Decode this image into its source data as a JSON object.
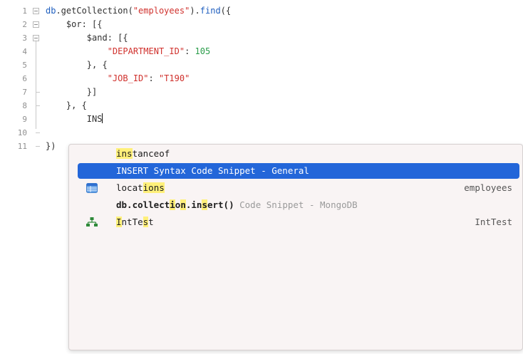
{
  "editor": {
    "line_numbers": [
      "1",
      "2",
      "3",
      "4",
      "5",
      "6",
      "7",
      "8",
      "9",
      "10",
      "11"
    ],
    "lines": [
      {
        "parts": [
          {
            "t": "db",
            "c": "kw"
          },
          {
            "t": ".getCollection(",
            "c": "plain"
          },
          {
            "t": "\"employees\"",
            "c": "str"
          },
          {
            "t": ").",
            "c": "plain"
          },
          {
            "t": "find",
            "c": "fn"
          },
          {
            "t": "({",
            "c": "plain"
          }
        ]
      },
      {
        "parts": [
          {
            "t": "    $or: [{",
            "c": "plain"
          }
        ]
      },
      {
        "parts": [
          {
            "t": "        $and: [{",
            "c": "plain"
          }
        ]
      },
      {
        "parts": [
          {
            "t": "            ",
            "c": "plain"
          },
          {
            "t": "\"DEPARTMENT_ID\"",
            "c": "str"
          },
          {
            "t": ": ",
            "c": "plain"
          },
          {
            "t": "105",
            "c": "num"
          }
        ]
      },
      {
        "parts": [
          {
            "t": "        }, {",
            "c": "plain"
          }
        ]
      },
      {
        "parts": [
          {
            "t": "            ",
            "c": "plain"
          },
          {
            "t": "\"JOB_ID\"",
            "c": "str"
          },
          {
            "t": ": ",
            "c": "plain"
          },
          {
            "t": "\"T190\"",
            "c": "str"
          }
        ]
      },
      {
        "parts": [
          {
            "t": "        }]",
            "c": "plain"
          }
        ]
      },
      {
        "parts": [
          {
            "t": "    }, {",
            "c": "plain"
          }
        ]
      },
      {
        "parts": [
          {
            "t": "        INS",
            "c": "plain"
          }
        ]
      },
      {
        "parts": []
      },
      {
        "parts": [
          {
            "t": "})",
            "c": "plain"
          }
        ]
      }
    ]
  },
  "autocomplete": {
    "items": [
      {
        "icon": "none",
        "segments": [
          {
            "t": "ins",
            "hl": true
          },
          {
            "t": "tanceof"
          }
        ],
        "right": "",
        "selected": false
      },
      {
        "icon": "none",
        "segments": [
          {
            "t": "INSERT Syntax Code Snippet - General"
          }
        ],
        "right": "",
        "selected": true
      },
      {
        "icon": "table-icon",
        "segments": [
          {
            "t": "locat"
          },
          {
            "t": "ions",
            "hl": true
          }
        ],
        "right": "employees",
        "selected": false
      },
      {
        "icon": "none",
        "segments": [
          {
            "t": "db.collect",
            "b": true
          },
          {
            "t": "i",
            "hl": true,
            "b": true
          },
          {
            "t": "o",
            "b": true
          },
          {
            "t": "n",
            "hl": true,
            "b": true
          },
          {
            "t": ".in",
            "b": true
          },
          {
            "t": "s",
            "hl": true,
            "b": true
          },
          {
            "t": "ert()",
            "b": true
          },
          {
            "t": " Code Snippet - MongoDB",
            "hint": true
          }
        ],
        "right": "",
        "selected": false
      },
      {
        "icon": "network-icon",
        "segments": [
          {
            "t": "I",
            "hl": true
          },
          {
            "t": "ntTe"
          },
          {
            "t": "s",
            "hl": true
          },
          {
            "t": "t"
          }
        ],
        "right": "IntTest",
        "selected": false
      }
    ]
  }
}
